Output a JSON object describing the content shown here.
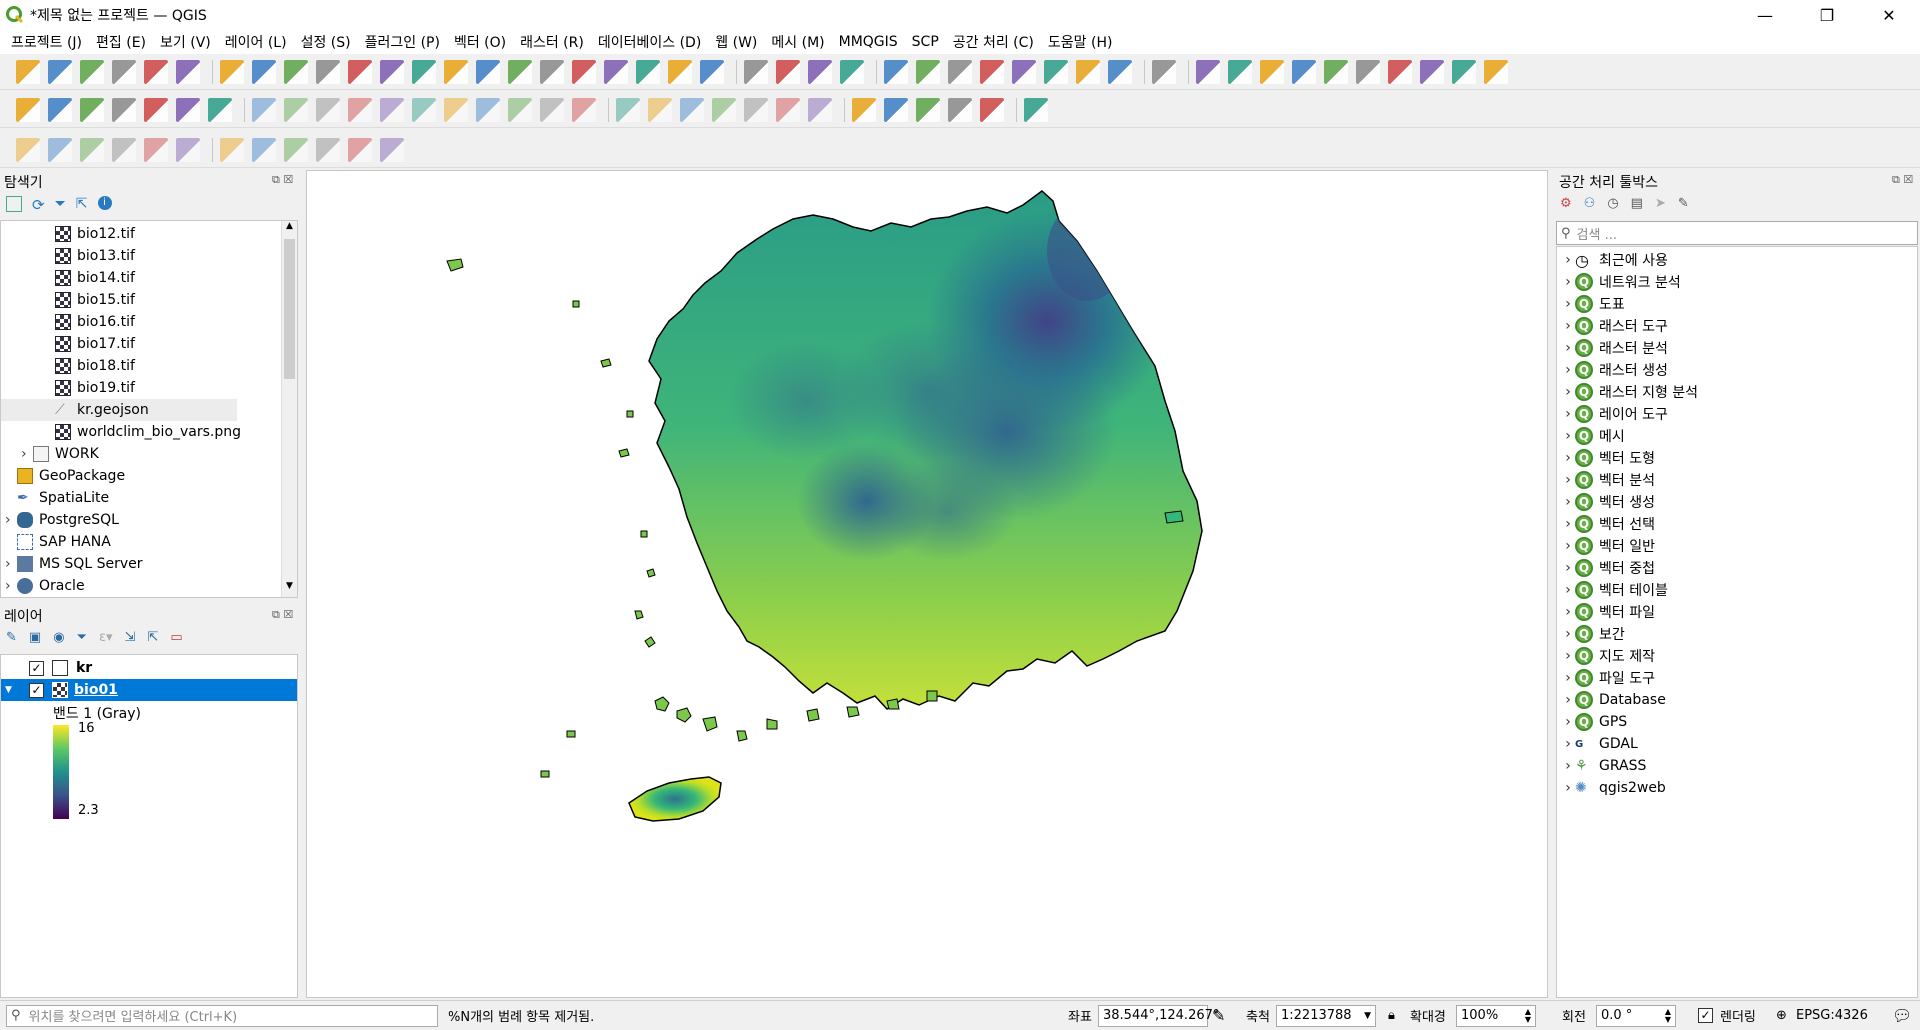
{
  "window": {
    "title": "*제목 없는 프로젝트 — QGIS"
  },
  "menubar": {
    "items": [
      "프로젝트 (J)",
      "편집 (E)",
      "보기 (V)",
      "레이어 (L)",
      "설정 (S)",
      "플러그인 (P)",
      "벡터 (O)",
      "래스터 (R)",
      "데이터베이스 (D)",
      "웹 (W)",
      "메시 (M)",
      "MMQGIS",
      "SCP",
      "공간 처리 (C)",
      "도움말 (H)"
    ]
  },
  "browser_panel": {
    "title": "탐색기",
    "items": [
      {
        "label": "bio12.tif",
        "type": "raster"
      },
      {
        "label": "bio13.tif",
        "type": "raster"
      },
      {
        "label": "bio14.tif",
        "type": "raster"
      },
      {
        "label": "bio15.tif",
        "type": "raster"
      },
      {
        "label": "bio16.tif",
        "type": "raster"
      },
      {
        "label": "bio17.tif",
        "type": "raster"
      },
      {
        "label": "bio18.tif",
        "type": "raster"
      },
      {
        "label": "bio19.tif",
        "type": "raster"
      },
      {
        "label": "kr.geojson",
        "type": "vector"
      },
      {
        "label": "worldclim_bio_vars.png",
        "type": "raster"
      },
      {
        "label": "WORK",
        "type": "folder"
      },
      {
        "label": "GeoPackage",
        "type": "gpkg"
      },
      {
        "label": "SpatiaLite",
        "type": "spatialite"
      },
      {
        "label": "PostgreSQL",
        "type": "postgres"
      },
      {
        "label": "SAP HANA",
        "type": "hana"
      },
      {
        "label": "MS SQL Server",
        "type": "mssql"
      },
      {
        "label": "Oracle",
        "type": "oracle"
      }
    ]
  },
  "layers_panel": {
    "title": "레이어",
    "layers": [
      {
        "name": "kr",
        "checked": true
      },
      {
        "name": "bio01",
        "checked": true,
        "selected": true
      }
    ],
    "legend": {
      "band": "밴드 1 (Gray)",
      "max": "16",
      "min": "2.3"
    }
  },
  "processing_panel": {
    "title": "공간 처리 툴박스",
    "search_placeholder": "검색 ...",
    "items": [
      "최근에 사용",
      "네트워크 분석",
      "도표",
      "래스터 도구",
      "래스터 분석",
      "래스터 생성",
      "래스터 지형 분석",
      "레이어 도구",
      "메시",
      "벡터 도형",
      "벡터 분석",
      "벡터 생성",
      "벡터 선택",
      "벡터 일반",
      "벡터 중첩",
      "벡터 테이블",
      "벡터 파일",
      "보간",
      "지도 제작",
      "파일 도구",
      "Database",
      "GPS",
      "GDAL",
      "GRASS",
      "qgis2web"
    ]
  },
  "statusbar": {
    "locator_placeholder": "위치를 찾으려면 입력하세요 (Ctrl+K)",
    "message": "%N개의 범례 항목 제거됨.",
    "coord_label": "좌표",
    "coord_value": "38.544°,124.267°",
    "scale_label": "축척",
    "scale_value": "1:2213788",
    "magnifier_label": "확대경",
    "magnifier_value": "100%",
    "rotation_label": "회전",
    "rotation_value": "0.0 °",
    "render_label": "렌더링",
    "crs": "EPSG:4326"
  },
  "colors": {
    "selection": "#0078d7",
    "viridis_low": "#440154",
    "viridis_mid": "#21918c",
    "viridis_high": "#fde725"
  }
}
